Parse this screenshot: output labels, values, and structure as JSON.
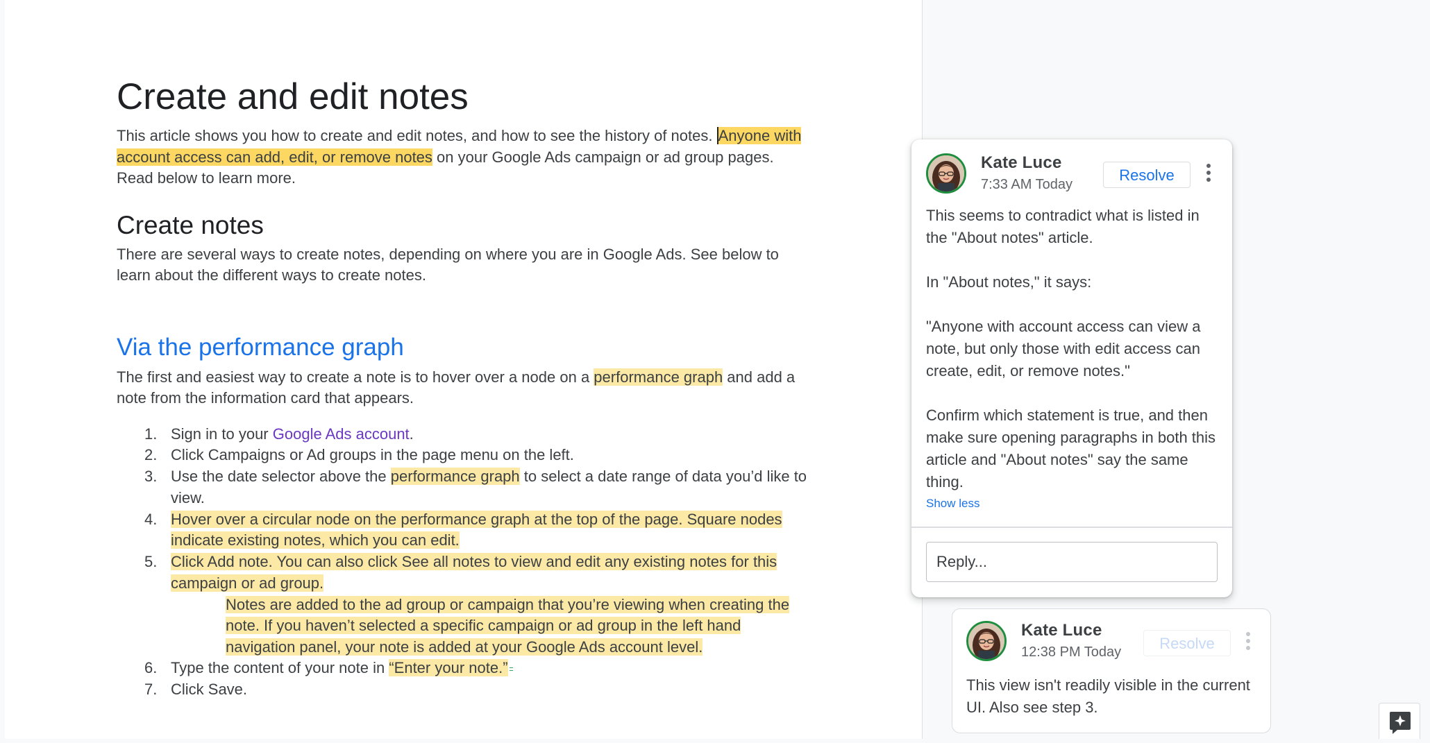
{
  "document": {
    "title": "Create and edit notes",
    "intro": {
      "part1": "This article shows you how to create and edit notes, and how to see the history of notes. ",
      "highlight": "Anyone with account access can add, edit, or remove notes",
      "part2": " on your Google Ads campaign or ad group pages. Read below to learn more."
    },
    "section_create": {
      "heading": "Create notes",
      "body": "There are several ways to create notes, depending on where you are in Google Ads. See below to learn about the different ways to create notes."
    },
    "section_graph": {
      "heading": "Via the performance graph",
      "body_part1": "The first and easiest way to create a note is to hover over a node on a ",
      "body_highlight": "performance graph",
      "body_part2": " and add a note from the information card that appears."
    },
    "steps": {
      "s1": {
        "num": "1.",
        "pre": "Sign in to your ",
        "link": "Google Ads account",
        "post": "."
      },
      "s2": {
        "num": "2.",
        "text": "Click Campaigns or Ad groups in the page menu on the left."
      },
      "s3": {
        "num": "3.",
        "pre": "Use the date selector above the ",
        "highlight": "performance graph",
        "post": " to select a date range of data you’d like to view."
      },
      "s4": {
        "num": "4.",
        "text": "Hover over a circular node on the performance graph at the top of the page. Square nodes indicate existing notes, which you can edit. "
      },
      "s5": {
        "num": "5.",
        "text": "Click Add note. You can also click See all notes to view and edit any existing notes for this campaign or ad group. "
      },
      "s5_note": "Notes are added to the ad group or campaign that you’re viewing when creating the note. If you haven’t selected a specific campaign or ad group in the left hand navigation panel, your note is added at your Google Ads account level.",
      "s6": {
        "num": "6.",
        "pre": "Type the content of your note in ",
        "highlight": "“Enter your note.”"
      },
      "s7": {
        "num": "7.",
        "text": "Click Save."
      }
    }
  },
  "comments": {
    "active": {
      "author": "Kate Luce",
      "time": "7:33 AM Today",
      "resolve_label": "Resolve",
      "paragraphs": {
        "p1": "This seems to contradict what is listed in the \"About notes\" article.",
        "p2": "In \"About notes,\" it says:",
        "p3": "\"Anyone with account access can view a note, but only those with edit access can create, edit, or remove notes.\"",
        "p4": "Confirm which statement is true, and then make sure opening paragraphs in both this article and \"About notes\" say the same thing."
      },
      "show_less": "Show less",
      "reply_placeholder": "Reply..."
    },
    "second": {
      "author": "Kate Luce",
      "time": "12:38 PM Today",
      "resolve_label": "Resolve",
      "body": "This view isn't readily visible in the current UI. Also see step 3."
    }
  },
  "icons": {
    "kebab": "more-vert-icon",
    "add_comment": "add-comment-icon",
    "avatar": "user-avatar"
  },
  "colors": {
    "accent": "#1a73e8",
    "highlight": "#fde9a6",
    "active_highlight": "#fcd863",
    "link": "#6a38c2",
    "avatar_ring": "#1e8e3e"
  }
}
